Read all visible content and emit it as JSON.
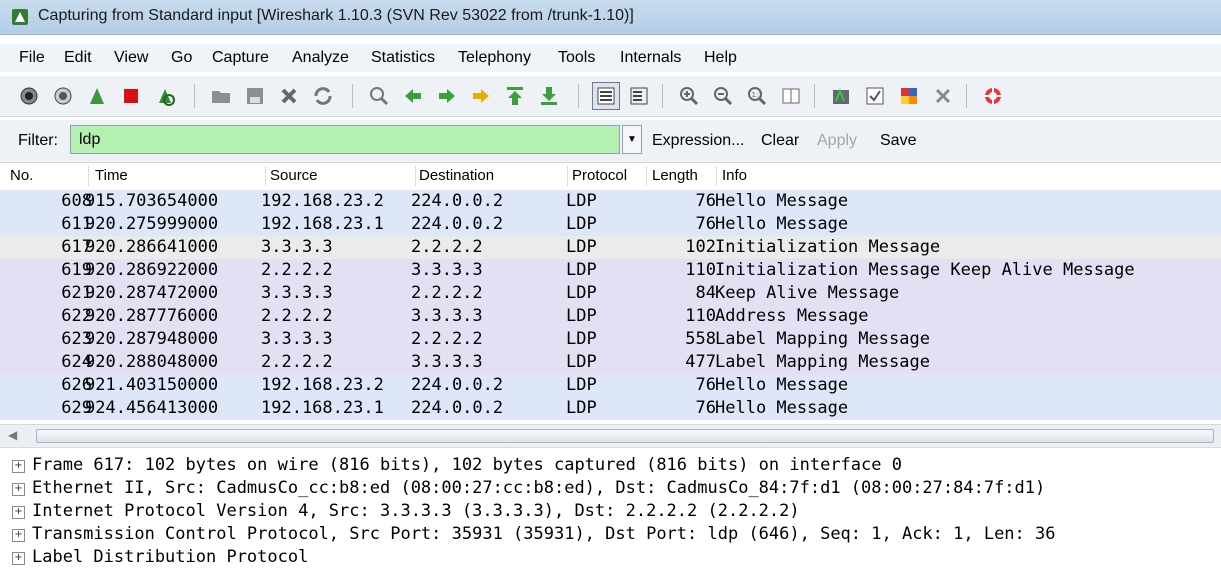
{
  "window": {
    "title": "Capturing from Standard input    [Wireshark 1.10.3  (SVN Rev 53022 from /trunk-1.10)]"
  },
  "menu": [
    "File",
    "Edit",
    "View",
    "Go",
    "Capture",
    "Analyze",
    "Statistics",
    "Telephony",
    "Tools",
    "Internals",
    "Help"
  ],
  "toolbar": {
    "icons": [
      "interfaces-icon",
      "options-icon",
      "start-capture-icon",
      "stop-capture-icon",
      "restart-capture-icon",
      "open-file-icon",
      "save-file-icon",
      "close-file-icon",
      "reload-icon",
      "find-packet-icon",
      "go-back-icon",
      "go-forward-icon",
      "go-to-packet-icon",
      "go-first-icon",
      "go-last-icon",
      "colorize-icon",
      "auto-scroll-icon",
      "zoom-in-icon",
      "zoom-out-icon",
      "normal-size-icon",
      "resize-columns-icon",
      "capture-filters-icon",
      "display-filters-icon",
      "coloring-rules-icon",
      "preferences-icon",
      "help-icon"
    ]
  },
  "filter": {
    "label": "Filter:",
    "value": "ldp",
    "expression": "Expression...",
    "clear": "Clear",
    "apply": "Apply",
    "save": "Save"
  },
  "columns": [
    "No.",
    "Time",
    "Source",
    "Destination",
    "Protocol",
    "Length",
    "Info"
  ],
  "packets": [
    {
      "no": "608",
      "time": "915.703654000",
      "src": "192.168.23.2",
      "dst": "224.0.0.2",
      "proto": "LDP",
      "len": "76",
      "info": "Hello Message",
      "color": "#dde7f7"
    },
    {
      "no": "611",
      "time": "920.275999000",
      "src": "192.168.23.1",
      "dst": "224.0.0.2",
      "proto": "LDP",
      "len": "76",
      "info": "Hello Message",
      "color": "#dde7f7"
    },
    {
      "no": "617",
      "time": "920.286641000",
      "src": "3.3.3.3",
      "dst": "2.2.2.2",
      "proto": "LDP",
      "len": "102",
      "info": "Initialization Message",
      "color": "#ebebeb"
    },
    {
      "no": "619",
      "time": "920.286922000",
      "src": "2.2.2.2",
      "dst": "3.3.3.3",
      "proto": "LDP",
      "len": "110",
      "info": "Initialization Message Keep Alive Message",
      "color": "#e4e0f3"
    },
    {
      "no": "621",
      "time": "920.287472000",
      "src": "3.3.3.3",
      "dst": "2.2.2.2",
      "proto": "LDP",
      "len": "84",
      "info": "Keep Alive Message",
      "color": "#e4e0f3"
    },
    {
      "no": "622",
      "time": "920.287776000",
      "src": "2.2.2.2",
      "dst": "3.3.3.3",
      "proto": "LDP",
      "len": "110",
      "info": "Address Message",
      "color": "#e4e0f3"
    },
    {
      "no": "623",
      "time": "920.287948000",
      "src": "3.3.3.3",
      "dst": "2.2.2.2",
      "proto": "LDP",
      "len": "558",
      "info": "Label Mapping Message",
      "color": "#e4e0f3"
    },
    {
      "no": "624",
      "time": "920.288048000",
      "src": "2.2.2.2",
      "dst": "3.3.3.3",
      "proto": "LDP",
      "len": "477",
      "info": "Label Mapping Message",
      "color": "#e4e0f3"
    },
    {
      "no": "626",
      "time": "921.403150000",
      "src": "192.168.23.2",
      "dst": "224.0.0.2",
      "proto": "LDP",
      "len": "76",
      "info": "Hello Message",
      "color": "#dde7f7"
    },
    {
      "no": "629",
      "time": "924.456413000",
      "src": "192.168.23.1",
      "dst": "224.0.0.2",
      "proto": "LDP",
      "len": "76",
      "info": "Hello Message",
      "color": "#dde7f7"
    }
  ],
  "details": [
    "Frame 617: 102 bytes on wire (816 bits), 102 bytes captured (816 bits) on interface 0",
    "Ethernet II, Src: CadmusCo_cc:b8:ed (08:00:27:cc:b8:ed), Dst: CadmusCo_84:7f:d1 (08:00:27:84:7f:d1)",
    "Internet Protocol Version 4, Src: 3.3.3.3 (3.3.3.3), Dst: 2.2.2.2 (2.2.2.2)",
    "Transmission Control Protocol, Src Port: 35931 (35931), Dst Port: ldp (646), Seq: 1, Ack: 1, Len: 36",
    "Label Distribution Protocol"
  ]
}
